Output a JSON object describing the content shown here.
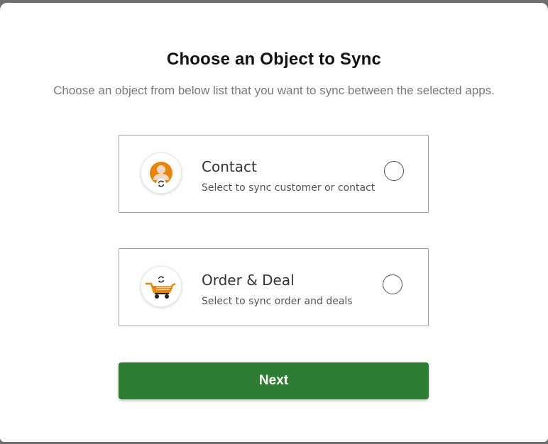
{
  "dialog": {
    "title": "Choose an Object to Sync",
    "subtitle": "Choose an object from below list that you want to sync between the selected apps."
  },
  "options": [
    {
      "title": "Contact",
      "description": "Select to sync customer or contact",
      "icon": "contact-sync-icon",
      "selected": false
    },
    {
      "title": "Order & Deal",
      "description": "Select to sync order and deals",
      "icon": "cart-sync-icon",
      "selected": false
    }
  ],
  "next_label": "Next",
  "colors": {
    "primary_button": "#2e7d32",
    "icon_orange": "#e8850c",
    "border": "#9e9e9e"
  }
}
